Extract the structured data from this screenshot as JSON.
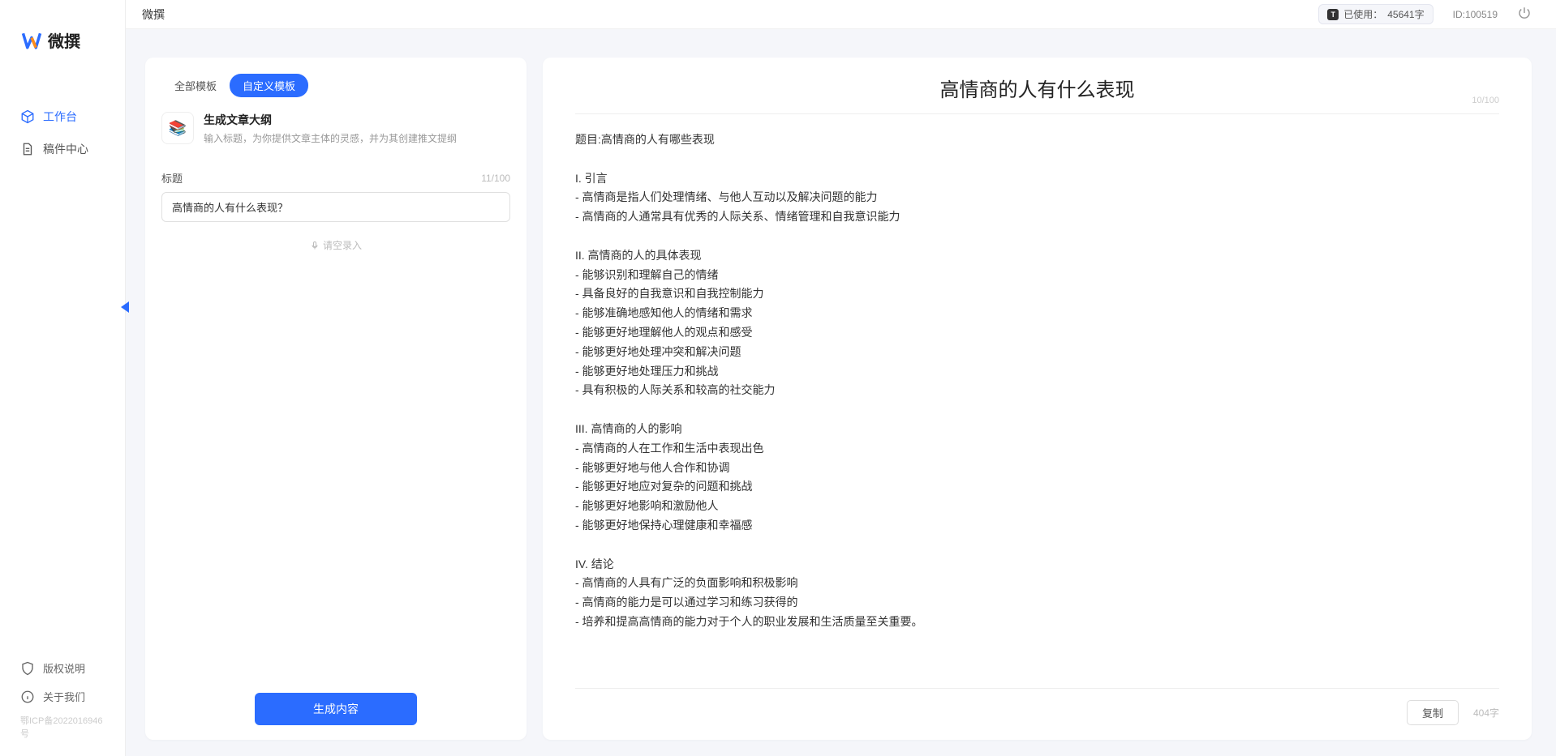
{
  "app": {
    "brand": "微撰",
    "title": "微撰"
  },
  "sidebar": {
    "nav": [
      {
        "label": "工作台",
        "icon": "cube"
      },
      {
        "label": "稿件中心",
        "icon": "doc"
      }
    ],
    "bottom": [
      {
        "label": "版权说明",
        "icon": "shield"
      },
      {
        "label": "关于我们",
        "icon": "info"
      }
    ],
    "icp": "鄂ICP备2022016946号"
  },
  "topbar": {
    "usage_label": "已使用：",
    "usage_value": "45641字",
    "user_id_label": "ID:100519"
  },
  "left": {
    "tabs": [
      {
        "label": "全部模板",
        "active": false
      },
      {
        "label": "自定义模板",
        "active": true
      }
    ],
    "template": {
      "icon": "📚",
      "title": "生成文章大纲",
      "desc": "输入标题，为你提供文章主体的灵感，并为其创建推文提纲"
    },
    "form": {
      "title_label": "标题",
      "title_count": "11/100",
      "title_value": "高情商的人有什么表现？",
      "voice_hint": "请空录入"
    },
    "generate_btn": "生成内容"
  },
  "right": {
    "title": "高情商的人有什么表现",
    "title_count": "10/100",
    "body": "题目:高情商的人有哪些表现\n\nI. 引言\n- 高情商是指人们处理情绪、与他人互动以及解决问题的能力\n- 高情商的人通常具有优秀的人际关系、情绪管理和自我意识能力\n\nII. 高情商的人的具体表现\n- 能够识别和理解自己的情绪\n- 具备良好的自我意识和自我控制能力\n- 能够准确地感知他人的情绪和需求\n- 能够更好地理解他人的观点和感受\n- 能够更好地处理冲突和解决问题\n- 能够更好地处理压力和挑战\n- 具有积极的人际关系和较高的社交能力\n\nIII. 高情商的人的影响\n- 高情商的人在工作和生活中表现出色\n- 能够更好地与他人合作和协调\n- 能够更好地应对复杂的问题和挑战\n- 能够更好地影响和激励他人\n- 能够更好地保持心理健康和幸福感\n\nIV. 结论\n- 高情商的人具有广泛的负面影响和积极影响\n- 高情商的能力是可以通过学习和练习获得的\n- 培养和提高高情商的能力对于个人的职业发展和生活质量至关重要。",
    "copy_btn": "复制",
    "word_count": "404字"
  }
}
